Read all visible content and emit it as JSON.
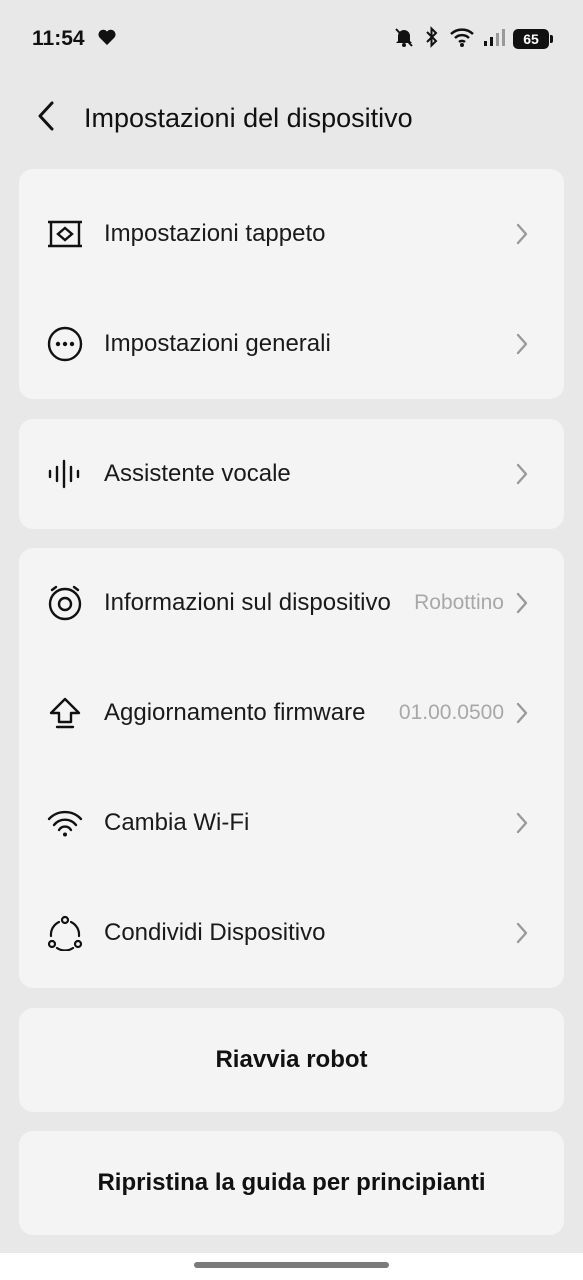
{
  "status_bar": {
    "time": "11:54",
    "battery": "65"
  },
  "header": {
    "title": "Impostazioni del dispositivo"
  },
  "group1": {
    "items": [
      {
        "label": "Impostazioni tappeto",
        "icon": "carpet-icon"
      },
      {
        "label": "Impostazioni generali",
        "icon": "more-circle-icon"
      }
    ]
  },
  "group2": {
    "items": [
      {
        "label": "Assistente vocale",
        "icon": "voice-wave-icon"
      }
    ]
  },
  "group3": {
    "items": [
      {
        "label": "Informazioni sul dispositivo",
        "value": "Robottino",
        "icon": "robot-icon"
      },
      {
        "label": "Aggiornamento firmware",
        "value": "01.00.0500",
        "icon": "upload-arrow-icon"
      },
      {
        "label": "Cambia Wi-Fi",
        "icon": "wifi-icon"
      },
      {
        "label": "Condividi Dispositivo",
        "icon": "share-icon"
      }
    ]
  },
  "actions": {
    "restart": "Riavvia robot",
    "reset_guide": "Ripristina la guida per principianti"
  }
}
